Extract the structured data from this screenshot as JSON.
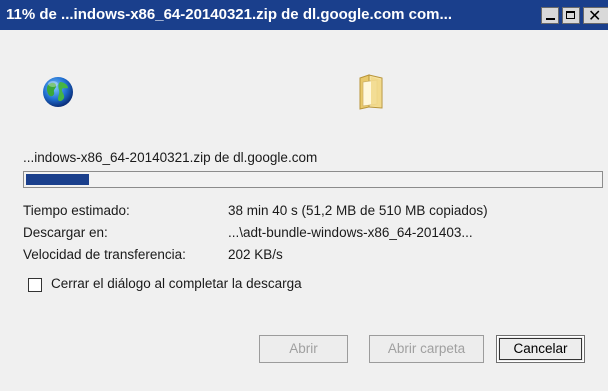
{
  "window": {
    "title": "11% de ...indows-x86_64-20140321.zip de dl.google.com com...",
    "close_glyph": "✕"
  },
  "icons": {
    "source": "globe-icon",
    "destination": "folder-icon"
  },
  "download": {
    "filename": "...indows-x86_64-20140321.zip de dl.google.com",
    "progress_fraction": 0.11,
    "accent_color": "#1a3f8c"
  },
  "details": {
    "time_label": "Tiempo estimado:",
    "time_value": "38 min 40 s (51,2 MB de 510 MB copiados)",
    "dest_label": "Descargar en:",
    "dest_value": "...\\adt-bundle-windows-x86_64-201403...",
    "speed_label": "Velocidad de transferencia:",
    "speed_value": "202 KB/s"
  },
  "options": {
    "close_on_complete_label": "Cerrar el diálogo al completar la descarga",
    "close_on_complete_checked": false
  },
  "buttons": {
    "open_label": "Abrir",
    "open_folder_label": "Abrir carpeta",
    "cancel_label": "Cancelar"
  }
}
